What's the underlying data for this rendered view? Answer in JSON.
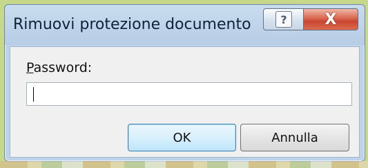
{
  "dialog": {
    "title": "Rimuovi protezione documento",
    "titlebar_buttons": {
      "help_symbol": "?",
      "close_symbol": "X",
      "help_icon": "help-icon",
      "close_icon": "close-icon"
    }
  },
  "form": {
    "password_label_access_key": "P",
    "password_label_rest": "assword:",
    "password_value": ""
  },
  "buttons": {
    "ok_label": "OK",
    "cancel_label": "Annulla"
  },
  "colors": {
    "close_button_red": "#c94632",
    "ok_button_border": "#3c7fb1",
    "window_frame": "#bcd3ea"
  }
}
